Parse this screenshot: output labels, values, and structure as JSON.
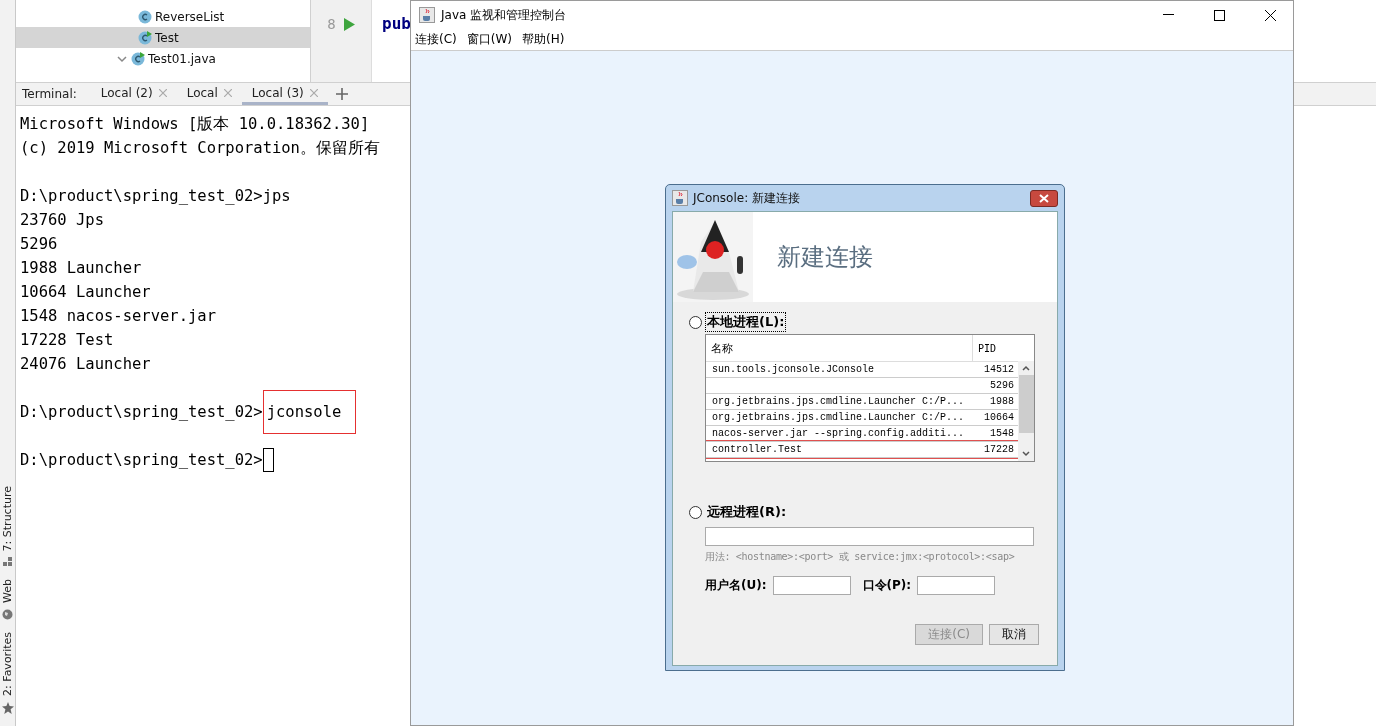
{
  "ide": {
    "side_tools": [
      {
        "label": "7: Structure",
        "kind": "structure"
      },
      {
        "label": "Web",
        "kind": "web"
      },
      {
        "label": "2: Favorites",
        "kind": "favorites"
      }
    ],
    "project_tree": [
      {
        "label": "ReverseList",
        "kind": "class",
        "selected": false
      },
      {
        "label": "Test",
        "kind": "runnable",
        "selected": true
      },
      {
        "label": "Test01.java",
        "kind": "runnable",
        "selected": false,
        "expanded": true
      }
    ],
    "editor": {
      "line_number": "8",
      "code": "pub"
    },
    "terminal": {
      "label": "Terminal:",
      "tabs": [
        {
          "label": "Local (2)",
          "selected": false
        },
        {
          "label": "Local",
          "selected": false
        },
        {
          "label": "Local (3)",
          "selected": true
        }
      ],
      "lines": [
        {
          "kind": "output",
          "text": "Microsoft Windows [版本 10.0.18362.30]"
        },
        {
          "kind": "output",
          "text": "(c) 2019 Microsoft Corporation。保留所有"
        },
        {
          "kind": "blank"
        },
        {
          "kind": "prompt",
          "prompt": "D:\\product\\spring_test_02>",
          "command": "jps",
          "highlight": false
        },
        {
          "kind": "output",
          "text": "23760 Jps"
        },
        {
          "kind": "output",
          "text": "5296"
        },
        {
          "kind": "output",
          "text": "1988 Launcher"
        },
        {
          "kind": "output",
          "text": "10664 Launcher"
        },
        {
          "kind": "output",
          "text": "1548 nacos-server.jar"
        },
        {
          "kind": "output",
          "text": "17228 Test"
        },
        {
          "kind": "output",
          "text": "24076 Launcher"
        },
        {
          "kind": "blank"
        },
        {
          "kind": "prompt",
          "prompt": "D:\\product\\spring_test_02>",
          "command": "jconsole",
          "highlight": true
        },
        {
          "kind": "blank"
        },
        {
          "kind": "prompt",
          "prompt": "D:\\product\\spring_test_02>",
          "cursor": true
        }
      ]
    }
  },
  "java_window": {
    "title": "Java 监视和管理控制台",
    "menu": [
      "连接(C)",
      "窗口(W)",
      "帮助(H)"
    ]
  },
  "dialog": {
    "title": "JConsole: 新建连接",
    "heading": "新建连接",
    "local": {
      "label": "本地进程(L):",
      "selected": false,
      "columns": [
        "名称",
        "PID"
      ],
      "rows": [
        {
          "name": "sun.tools.jconsole.JConsole",
          "pid": "14512",
          "highlight": false
        },
        {
          "pid": "5296",
          "highlight": false
        },
        {
          "name": "org.jetbrains.jps.cmdline.Launcher C:/P...",
          "pid": "1988",
          "highlight": false
        },
        {
          "name": "org.jetbrains.jps.cmdline.Launcher C:/P...",
          "pid": "10664",
          "highlight": false
        },
        {
          "name": "nacos-server.jar --spring.config.additi...",
          "pid": "1548",
          "highlight": false
        },
        {
          "name": "controller.Test",
          "pid": "17228",
          "highlight": true
        }
      ]
    },
    "remote": {
      "label": "远程进程(R):",
      "selected": false,
      "usage": "用法: <hostname>:<port> 或 service:jmx:<protocol>:<sap>",
      "username_label": "用户名(U):",
      "password_label": "口令(P):"
    },
    "buttons": [
      {
        "label": "连接(C)",
        "disabled": true
      },
      {
        "label": "取消",
        "disabled": false
      }
    ]
  }
}
